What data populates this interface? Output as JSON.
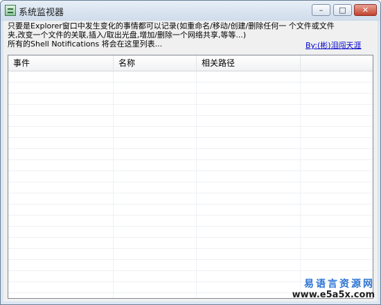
{
  "window": {
    "title": "系统监视器",
    "icon": "list-app-icon",
    "controls": {
      "minimize": "–",
      "maximize": "□",
      "close": "✕"
    }
  },
  "description": {
    "line1": "只要是Explorer窗口中发生变化的事情都可以记录(如重命名/移动/创建/删除任何一 个文件或文件",
    "line2": "夹,改变一个文件的关联,插入/取出光盘,增加/删除一个网络共享,等等...)",
    "line3": "所有的Shell Notifications 将会在这里列表..."
  },
  "author_link": "By:(彬)泪闯天涯",
  "listview": {
    "columns": [
      "事件",
      "名称",
      "相关路径",
      ""
    ],
    "rows": []
  },
  "watermark": {
    "top": "易语言资源网",
    "bottom": "www.e5a5x.com"
  },
  "colors": {
    "link": "#0000cc",
    "watermark_blue": "#2c74d4",
    "close_red": "#c2412e"
  }
}
